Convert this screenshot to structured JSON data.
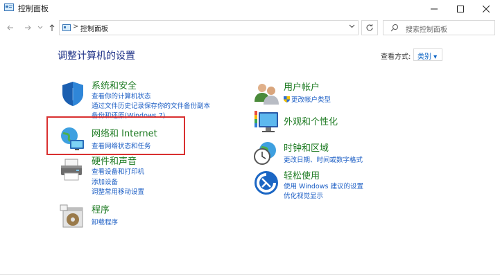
{
  "window": {
    "title": "控制面板"
  },
  "address": {
    "crumb": "控制面板",
    "separator": ">"
  },
  "search": {
    "placeholder": "搜索控制面板"
  },
  "main": {
    "heading": "调整计算机的设置"
  },
  "view": {
    "label": "查看方式:",
    "selected": "类别 ▾"
  },
  "categories": [
    {
      "title": "系统和安全",
      "links": [
        "查看你的计算机状态",
        "通过文件历史记录保存你的文件备份副本",
        "备份和还原(Windows 7)"
      ],
      "icon": "shield-icon"
    },
    {
      "title": "网络和 Internet",
      "links": [
        "查看网络状态和任务"
      ],
      "icon": "network-globe-icon"
    },
    {
      "title": "硬件和声音",
      "links": [
        "查看设备和打印机",
        "添加设备",
        "调整常用移动设置"
      ],
      "icon": "printer-icon"
    },
    {
      "title": "程序",
      "links": [
        "卸载程序"
      ],
      "icon": "programs-disc-icon"
    },
    {
      "title": "用户帐户",
      "links": [
        "更改帐户类型"
      ],
      "icon": "users-icon"
    },
    {
      "title": "外观和个性化",
      "links": [],
      "icon": "monitor-paint-icon"
    },
    {
      "title": "时钟和区域",
      "links": [
        "更改日期、时间或数字格式"
      ],
      "icon": "clock-globe-icon"
    },
    {
      "title": "轻松使用",
      "links": [
        "使用 Windows 建议的设置",
        "优化视觉显示"
      ],
      "icon": "ease-of-access-icon"
    }
  ],
  "colors": {
    "category_title": "#1c7a21",
    "link": "#1d5fc5",
    "heading": "#1e3287",
    "highlight_box": "#d93030"
  }
}
